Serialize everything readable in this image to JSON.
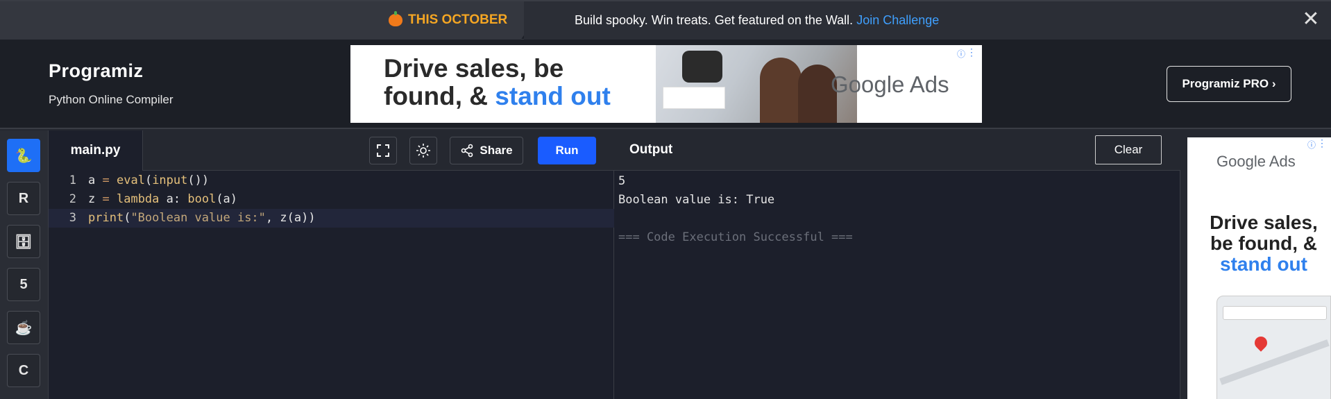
{
  "promo": {
    "tag": "THIS OCTOBER",
    "text": "Build spooky. Win treats. Get featured on the Wall.",
    "link": "Join Challenge",
    "close": "✕"
  },
  "header": {
    "logo": "Programiz",
    "subtitle": "Python Online Compiler",
    "pro_button": "Programiz PRO ›"
  },
  "ad_banner": {
    "headline_line1": "Drive sales, be",
    "headline_line2_a": "found, & ",
    "headline_line2_b": "stand out",
    "brand": "Google Ads"
  },
  "rail": {
    "items": [
      {
        "name": "python",
        "glyph": "🐍"
      },
      {
        "name": "r",
        "glyph": "R"
      },
      {
        "name": "sql",
        "glyph": "🗄"
      },
      {
        "name": "html",
        "glyph": "5"
      },
      {
        "name": "java",
        "glyph": "☕"
      },
      {
        "name": "c",
        "glyph": "C"
      }
    ]
  },
  "editor": {
    "file_tab": "main.py",
    "share_label": "Share",
    "run_label": "Run",
    "lines": [
      {
        "num": "1",
        "text": "a = eval(input())"
      },
      {
        "num": "2",
        "text": "z = lambda a: bool(a)"
      },
      {
        "num": "3",
        "text": "print(\"Boolean value is:\", z(a))"
      }
    ]
  },
  "output": {
    "title": "Output",
    "clear_label": "Clear",
    "line1": "5",
    "line2": "Boolean value is: True",
    "line3": "",
    "line4": "=== Code Execution Successful ==="
  },
  "side_ad": {
    "brand": "Google Ads",
    "headline_a": "Drive sales, be found, & ",
    "headline_b": "stand out"
  },
  "colors": {
    "accent": "#1a5cff",
    "link": "#3fa0ff",
    "promo_tag": "#f5a623"
  }
}
